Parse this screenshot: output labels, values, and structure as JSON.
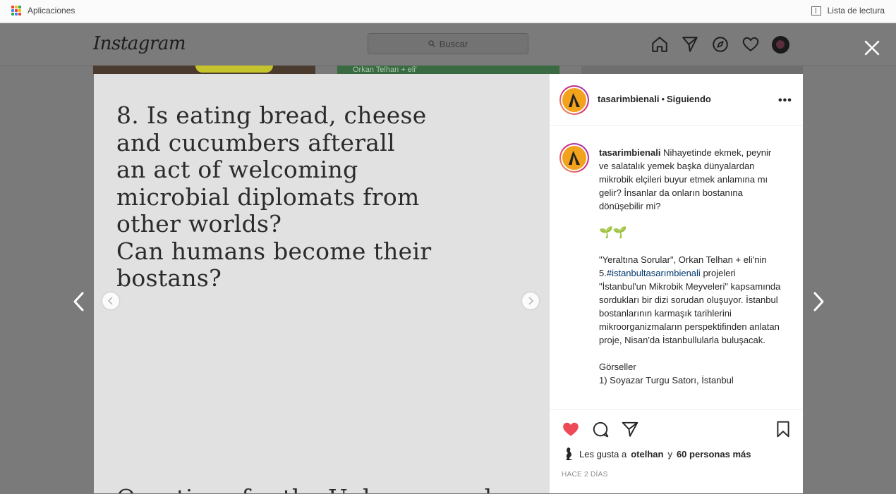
{
  "browser": {
    "apps_label": "Aplicaciones",
    "reading_list_label": "Lista de lectura",
    "apps_grid_colors": [
      "#e94235",
      "#fbbc04",
      "#34a853",
      "#4285f4",
      "#e94235",
      "#fbbc04",
      "#34a853",
      "#4285f4",
      "#e94235"
    ]
  },
  "instagram": {
    "logo": "Instagram",
    "search_placeholder": "Buscar",
    "nav_icons": [
      "home-icon",
      "direct-icon",
      "explore-icon",
      "activity-heart-icon",
      "profile-avatar"
    ],
    "background_tile_text": "Orkan Telhan + eli'"
  },
  "post": {
    "image_text_lines": [
      "8. Is eating bread, cheese",
      "and cucumbers afterall",
      "an act of welcoming",
      "microbial diplomats from",
      "other worlds?",
      "Can humans become their",
      "bostans?"
    ],
    "image_bottom_text": "Questions for the Unknown and",
    "author": "tasarimbienali",
    "follow_separator": "•",
    "follow_state": "Siguiendo",
    "more_label": "•••",
    "caption": {
      "username": "tasarimbienali",
      "p1": "Nihayetinde ekmek, peynir ve salatalık yemek başka dünyalardan mikrobik elçileri buyur etmek anlamına mı gelir? İnsanlar da onların bostanına dönüşebilir mi?",
      "emoji": "🌱🌱",
      "p3_before": "\"Yeraltına Sorular\", Orkan Telhan + eli'nin 5.",
      "hashtag": "#istanbultasarımbienali",
      "p3_after": "projeleri \"İstanbul'un Mikrobik Meyveleri\" kapsamında sordukları bir dizi sorudan oluşuyor. İstanbul bostanlarının karmaşık tarihlerini mikroorganizmaların perspektifinden anlatan proje, Nisan'da İstanbullularla buluşacak.",
      "p4_line1": "Görseller",
      "p4_line2": "1) Soyazar Turgu Satorı, İstanbul"
    },
    "likes_prefix": "Les gusta a",
    "likes_user": "otelhan",
    "likes_middle": "y",
    "likes_count": "60 personas más",
    "timestamp": "HACE 2 DÍAS",
    "like_color": "#ed4956"
  }
}
